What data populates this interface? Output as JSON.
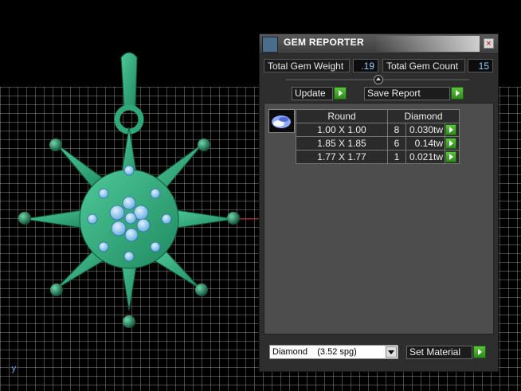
{
  "panel": {
    "title": "GEM REPORTER",
    "close_label": "×",
    "total_weight_label": "Total Gem Weight",
    "total_weight_value": ".19",
    "total_count_label": "Total Gem Count",
    "total_count_value": "15",
    "update_label": "Update",
    "save_report_label": "Save Report",
    "table": {
      "headers": [
        "Round",
        "Diamond"
      ],
      "rows": [
        {
          "size": "1.00 X 1.00",
          "count": "8",
          "weight": "0.030tw"
        },
        {
          "size": "1.85 X 1.85",
          "count": "6",
          "weight": "0.14tw"
        },
        {
          "size": "1.77 X 1.77",
          "count": "1",
          "weight": "0.021tw"
        }
      ]
    },
    "material": {
      "name": "Diamond",
      "spg": "(3.52 spg)"
    },
    "set_material_label": "Set Material"
  },
  "viewport": {
    "axis_label": "y"
  }
}
